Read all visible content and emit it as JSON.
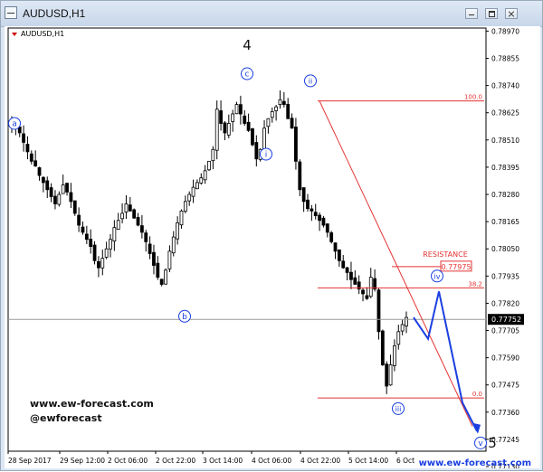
{
  "window": {
    "title": "AUDUSD,H1",
    "icon": "chart-window-icon",
    "controls": [
      "minimize-icon",
      "maximize-icon",
      "close-icon"
    ]
  },
  "chart_data": {
    "type": "candlestick",
    "title": "AUDUSD,H1",
    "symbol": "AUDUSD",
    "timeframe": "H1",
    "ylim": [
      0.77195,
      0.78983
    ],
    "y_ticks": [
      "0.78970",
      "0.78855",
      "0.78740",
      "0.78625",
      "0.78510",
      "0.78395",
      "0.78280",
      "0.78165",
      "0.78050",
      "0.77935",
      "0.77820",
      "0.77705",
      "0.77590",
      "0.77475",
      "0.77360",
      "0.77245",
      "0.77130"
    ],
    "x_ticks": [
      "28 Sep 2017",
      "29 Sep 12:00",
      "2 Oct 06:00",
      "2 Oct 22:00",
      "3 Oct 14:00",
      "4 Oct 06:00",
      "4 Oct 22:00",
      "5 Oct 14:00",
      "6 Oct"
    ],
    "current_price": "0.77752",
    "fibonacci": [
      {
        "level": "100.0",
        "price": 0.78675
      },
      {
        "level": "38.2",
        "price": 0.77885
      },
      {
        "level": "0.0",
        "price": 0.7742
      }
    ],
    "resistance": {
      "label": "RESISTANCE",
      "price": "0.77975"
    },
    "wave_labels": [
      {
        "label": "a",
        "price": 0.7858
      },
      {
        "label": "b",
        "price": 0.77765
      },
      {
        "label": "c",
        "price": 0.7879
      },
      {
        "label": "4",
        "price": 0.7891
      },
      {
        "label": "i",
        "price": 0.7845
      },
      {
        "label": "ii",
        "price": 0.7876
      },
      {
        "label": "iii",
        "price": 0.77375
      },
      {
        "label": "iv",
        "price": 0.77935
      },
      {
        "label": "v",
        "price": 0.7723
      },
      {
        "label": "5",
        "price": 0.7723
      }
    ],
    "projection": [
      0.7776,
      0.7767,
      0.7787,
      0.774,
      0.7728
    ],
    "price_path": [
      0.7858,
      0.7857,
      0.7854,
      0.785,
      0.7846,
      0.7842,
      0.784,
      0.7836,
      0.7833,
      0.783,
      0.7827,
      0.7824,
      0.7828,
      0.7832,
      0.7829,
      0.7825,
      0.782,
      0.7815,
      0.7812,
      0.7809,
      0.7806,
      0.78,
      0.7797,
      0.7801,
      0.7805,
      0.7809,
      0.7814,
      0.7817,
      0.782,
      0.7824,
      0.7821,
      0.7818,
      0.7815,
      0.7812,
      0.7808,
      0.7803,
      0.7798,
      0.7793,
      0.779,
      0.7796,
      0.7804,
      0.781,
      0.7816,
      0.7821,
      0.7825,
      0.7828,
      0.7831,
      0.7833,
      0.7835,
      0.7838,
      0.7842,
      0.7847,
      0.7864,
      0.7858,
      0.7854,
      0.7858,
      0.7862,
      0.7866,
      0.7862,
      0.7858,
      0.7855,
      0.7849,
      0.7843,
      0.7847,
      0.7856,
      0.786,
      0.7863,
      0.7865,
      0.7868,
      0.7866,
      0.786,
      0.7856,
      0.7842,
      0.783,
      0.7825,
      0.7822,
      0.7821,
      0.7819,
      0.7817,
      0.7815,
      0.7812,
      0.7808,
      0.7804,
      0.78,
      0.7797,
      0.7795,
      0.7792,
      0.779,
      0.7788,
      0.7786,
      0.7784,
      0.7793,
      0.7788,
      0.777,
      0.7756,
      0.7747,
      0.7756,
      0.7764,
      0.777,
      0.7773,
      0.7776
    ],
    "watermark": {
      "site": "www.ew-forecast.com",
      "handle": "@ewforecast",
      "footer": "www.ew-forecast.com"
    },
    "colors": {
      "candle": "#000000",
      "fib": "#e53333",
      "trendline": "#e53333",
      "projection": "#1a3fe0",
      "wave_circle": "#1a3fe0",
      "price_line": "#9a9a9a",
      "price_tag_bg": "#000000",
      "footer_text": "#1a3fe0"
    }
  }
}
